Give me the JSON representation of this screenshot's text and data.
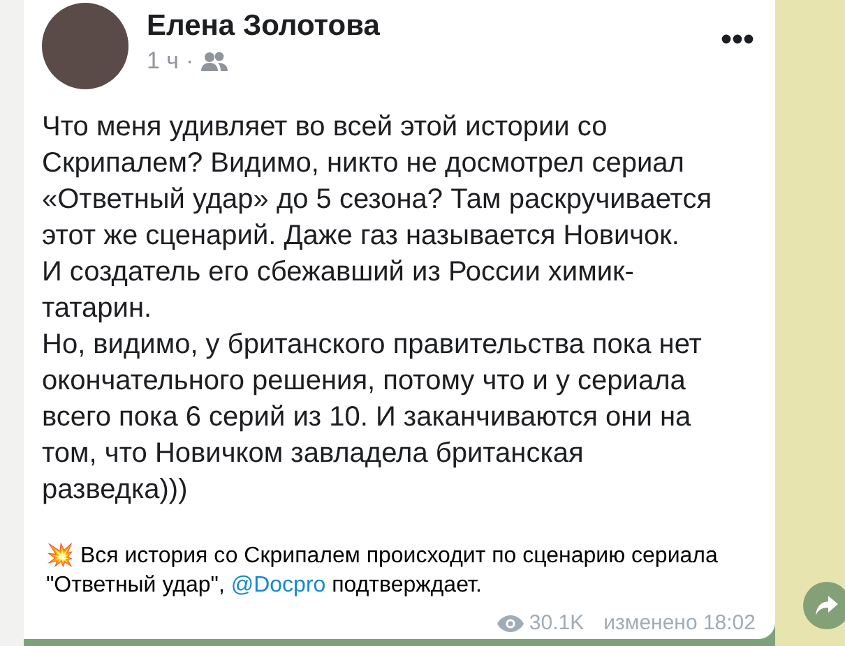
{
  "post_image": {
    "author": "Елена Золотова",
    "time": "1 ч",
    "separator": "·",
    "paragraphs": [
      [
        "Что меня удивляет во всей этой истории со",
        "Скрипалем? Видимо, никто не досмотрел сериал",
        "«Ответный удар» до 5 сезона? Там раскручивается",
        "этот же сценарий. Даже газ называется Новичок.",
        "И создатель его сбежавший из России химик-",
        "татарин."
      ],
      [
        "Но, видимо, у британского правительства пока нет",
        "окончательного решения, потому что и у сериала",
        "всего пока 6 серий из 10. И заканчиваются они на",
        "том, что Новичком завладела британская",
        "разведка)))"
      ]
    ]
  },
  "caption": {
    "emoji": "💥",
    "text_before": "Вся история со Скрипалем происходит по сценарию сериала \"Ответный удар\", ",
    "link": "@Docpro",
    "text_after": " подтверждает."
  },
  "views": "30.1K",
  "edited": "изменено 18:02"
}
